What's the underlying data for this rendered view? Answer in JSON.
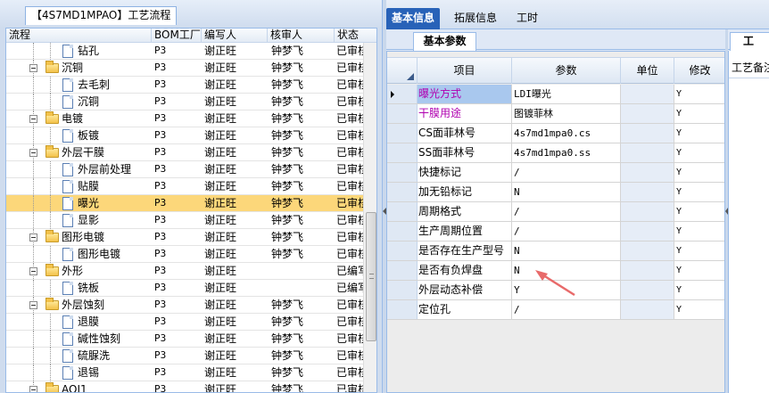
{
  "left": {
    "title": "【4S7MD1MPAO】工艺流程",
    "columns": [
      "流程",
      "BOM工厂",
      "编写人",
      "核审人",
      "状态"
    ],
    "rows": [
      {
        "level": 2,
        "type": "doc",
        "name": "钻孔",
        "bom": "P3",
        "writer": "谢正旺",
        "reviewer": "钟梦飞",
        "status": "已审核"
      },
      {
        "level": 1,
        "type": "folder",
        "name": "沉铜",
        "bom": "P3",
        "writer": "谢正旺",
        "reviewer": "钟梦飞",
        "status": "已审核"
      },
      {
        "level": 2,
        "type": "doc",
        "name": "去毛刺",
        "bom": "P3",
        "writer": "谢正旺",
        "reviewer": "钟梦飞",
        "status": "已审核"
      },
      {
        "level": 2,
        "type": "doc",
        "name": "沉铜",
        "bom": "P3",
        "writer": "谢正旺",
        "reviewer": "钟梦飞",
        "status": "已审核"
      },
      {
        "level": 1,
        "type": "folder",
        "name": "电镀",
        "bom": "P3",
        "writer": "谢正旺",
        "reviewer": "钟梦飞",
        "status": "已审核"
      },
      {
        "level": 2,
        "type": "doc",
        "name": "板镀",
        "bom": "P3",
        "writer": "谢正旺",
        "reviewer": "钟梦飞",
        "status": "已审核"
      },
      {
        "level": 1,
        "type": "folder",
        "name": "外层干膜",
        "bom": "P3",
        "writer": "谢正旺",
        "reviewer": "钟梦飞",
        "status": "已审核"
      },
      {
        "level": 2,
        "type": "doc",
        "name": "外层前处理",
        "bom": "P3",
        "writer": "谢正旺",
        "reviewer": "钟梦飞",
        "status": "已审核"
      },
      {
        "level": 2,
        "type": "doc",
        "name": "贴膜",
        "bom": "P3",
        "writer": "谢正旺",
        "reviewer": "钟梦飞",
        "status": "已审核"
      },
      {
        "level": 2,
        "type": "doc",
        "name": "曝光",
        "bom": "P3",
        "writer": "谢正旺",
        "reviewer": "钟梦飞",
        "status": "已审核",
        "selected": true
      },
      {
        "level": 2,
        "type": "doc",
        "name": "显影",
        "bom": "P3",
        "writer": "谢正旺",
        "reviewer": "钟梦飞",
        "status": "已审核"
      },
      {
        "level": 1,
        "type": "folder",
        "name": "图形电镀",
        "bom": "P3",
        "writer": "谢正旺",
        "reviewer": "钟梦飞",
        "status": "已审核"
      },
      {
        "level": 2,
        "type": "doc",
        "name": "图形电镀",
        "bom": "P3",
        "writer": "谢正旺",
        "reviewer": "钟梦飞",
        "status": "已审核"
      },
      {
        "level": 1,
        "type": "folder",
        "name": "外形",
        "bom": "P3",
        "writer": "谢正旺",
        "reviewer": "",
        "status": "已编写"
      },
      {
        "level": 2,
        "type": "doc",
        "name": "铣板",
        "bom": "P3",
        "writer": "谢正旺",
        "reviewer": "",
        "status": "已编写"
      },
      {
        "level": 1,
        "type": "folder",
        "name": "外层蚀刻",
        "bom": "P3",
        "writer": "谢正旺",
        "reviewer": "钟梦飞",
        "status": "已审核"
      },
      {
        "level": 2,
        "type": "doc",
        "name": "退膜",
        "bom": "P3",
        "writer": "谢正旺",
        "reviewer": "钟梦飞",
        "status": "已审核"
      },
      {
        "level": 2,
        "type": "doc",
        "name": "碱性蚀刻",
        "bom": "P3",
        "writer": "谢正旺",
        "reviewer": "钟梦飞",
        "status": "已审核"
      },
      {
        "level": 2,
        "type": "doc",
        "name": "硫脲洗",
        "bom": "P3",
        "writer": "谢正旺",
        "reviewer": "钟梦飞",
        "status": "已审核"
      },
      {
        "level": 2,
        "type": "doc",
        "name": "退锡",
        "bom": "P3",
        "writer": "谢正旺",
        "reviewer": "钟梦飞",
        "status": "已审核"
      },
      {
        "level": 1,
        "type": "folder",
        "name": "AOI1",
        "bom": "P3",
        "writer": "谢正旺",
        "reviewer": "钟梦飞",
        "status": "已审核"
      }
    ]
  },
  "right": {
    "tabs": [
      "基本信息",
      "拓展信息",
      "工时"
    ],
    "active_tab": 0,
    "sub_tab": "基本参数",
    "side_tab": "工",
    "side_label": "工艺备注",
    "columns": [
      "项目",
      "参数",
      "单位",
      "修改"
    ],
    "rows": [
      {
        "item": "曝光方式",
        "param": "LDI曝光",
        "unit": "",
        "mod": "Y"
      },
      {
        "item": "干膜用途",
        "param": "图镀菲林",
        "unit": "",
        "mod": "Y"
      },
      {
        "item": "CS面菲林号",
        "param": "4s7md1mpa0.cs",
        "unit": "",
        "mod": "Y"
      },
      {
        "item": "SS面菲林号",
        "param": "4s7md1mpa0.ss",
        "unit": "",
        "mod": "Y"
      },
      {
        "item": "快捷标记",
        "param": "/",
        "unit": "",
        "mod": "Y"
      },
      {
        "item": "加无铅标记",
        "param": "N",
        "unit": "",
        "mod": "Y"
      },
      {
        "item": "周期格式",
        "param": "/",
        "unit": "",
        "mod": "Y"
      },
      {
        "item": "生产周期位置",
        "param": "/",
        "unit": "",
        "mod": "Y"
      },
      {
        "item": "是否存在生产型号",
        "param": "N",
        "unit": "",
        "mod": "Y"
      },
      {
        "item": "是否有负焊盘",
        "param": "N",
        "unit": "",
        "mod": "Y"
      },
      {
        "item": "外层动态补偿",
        "param": "Y",
        "unit": "",
        "mod": "Y"
      },
      {
        "item": "定位孔",
        "param": "/",
        "unit": "",
        "mod": "Y"
      }
    ]
  },
  "colors": {
    "accent": "#2862b8",
    "selected_row": "#fcd77a",
    "highlight_text": "#b000b0",
    "annotation_arrow": "#e86a6a"
  }
}
